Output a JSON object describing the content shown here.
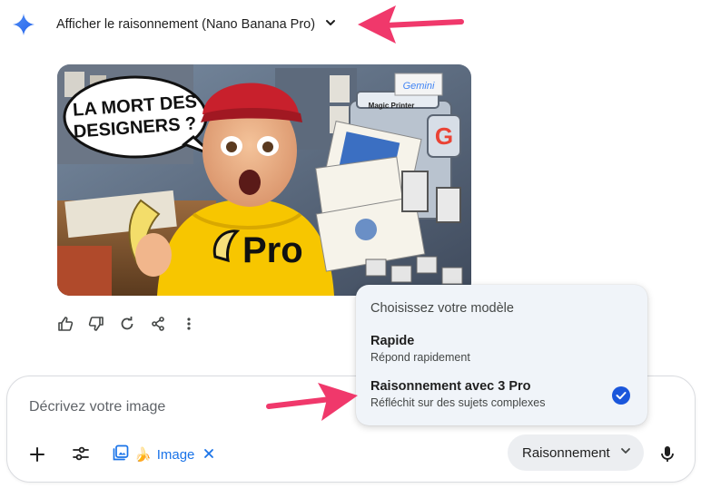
{
  "header": {
    "thinking_toggle_label": "Afficher le raisonnement (Nano Banana Pro)",
    "icons": {
      "logo": "gemini-star-icon",
      "toggle": "chevron-down-icon"
    }
  },
  "generated_image": {
    "bubble_text": "LA MORT DES DESIGNERS ?",
    "shirt_text": "Pro",
    "printer_label": "Magic Printer",
    "printer_brand": "Gemini"
  },
  "actions": {
    "icons": [
      "thumbs-up-icon",
      "thumbs-down-icon",
      "regenerate-icon",
      "share-icon",
      "more-vert-icon"
    ]
  },
  "model_menu": {
    "title": "Choisissez votre modèle",
    "options": [
      {
        "name": "Rapide",
        "description": "Répond rapidement",
        "selected": false
      },
      {
        "name": "Raisonnement avec 3 Pro",
        "description": "Réfléchit sur des sujets complexes",
        "selected": true
      }
    ]
  },
  "prompt": {
    "placeholder": "Décrivez votre image",
    "value": "",
    "image_chip": {
      "emoji": "🍌",
      "label": "Image"
    },
    "mode_label": "Raisonnement"
  },
  "colors": {
    "accent_blue": "#1a73e8",
    "annotation_arrow": "#f0386b",
    "menu_background": "#f0f4f9",
    "shirt_yellow": "#f7c600"
  }
}
